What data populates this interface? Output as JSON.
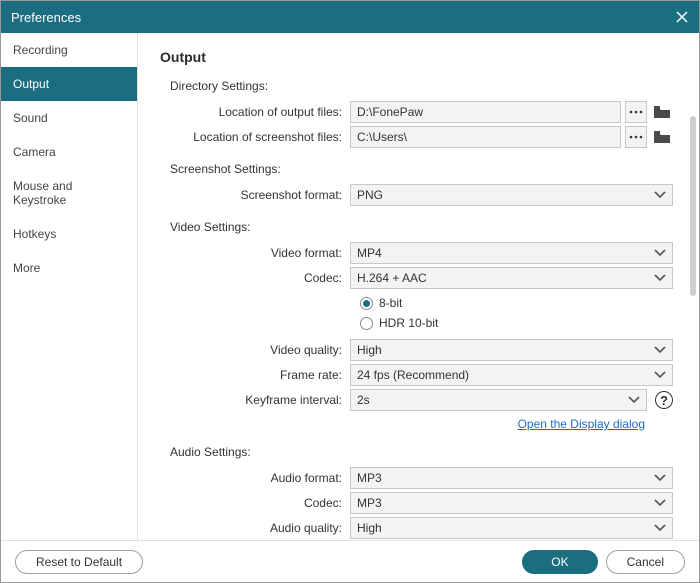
{
  "window": {
    "title": "Preferences"
  },
  "sidebar": {
    "items": [
      {
        "label": "Recording"
      },
      {
        "label": "Output"
      },
      {
        "label": "Sound"
      },
      {
        "label": "Camera"
      },
      {
        "label": "Mouse and Keystroke"
      },
      {
        "label": "Hotkeys"
      },
      {
        "label": "More"
      }
    ],
    "active_index": 1
  },
  "page": {
    "title": "Output",
    "directory": {
      "heading": "Directory Settings:",
      "output_label": "Location of output files:",
      "output_value": "D:\\FonePaw",
      "screenshot_label": "Location of screenshot files:",
      "screenshot_value": "C:\\Users\\"
    },
    "screenshot": {
      "heading": "Screenshot Settings:",
      "format_label": "Screenshot format:",
      "format_value": "PNG"
    },
    "video": {
      "heading": "Video Settings:",
      "format_label": "Video format:",
      "format_value": "MP4",
      "codec_label": "Codec:",
      "codec_value": "H.264 + AAC",
      "bitdepth_8": "8-bit",
      "bitdepth_hdr": "HDR 10-bit",
      "quality_label": "Video quality:",
      "quality_value": "High",
      "framerate_label": "Frame rate:",
      "framerate_value": "24 fps (Recommend)",
      "keyframe_label": "Keyframe interval:",
      "keyframe_value": "2s",
      "display_link": "Open the Display dialog"
    },
    "audio": {
      "heading": "Audio Settings:",
      "format_label": "Audio format:",
      "format_value": "MP3",
      "codec_label": "Codec:",
      "codec_value": "MP3",
      "quality_label": "Audio quality:",
      "quality_value": "High"
    }
  },
  "footer": {
    "reset": "Reset to Default",
    "ok": "OK",
    "cancel": "Cancel"
  }
}
